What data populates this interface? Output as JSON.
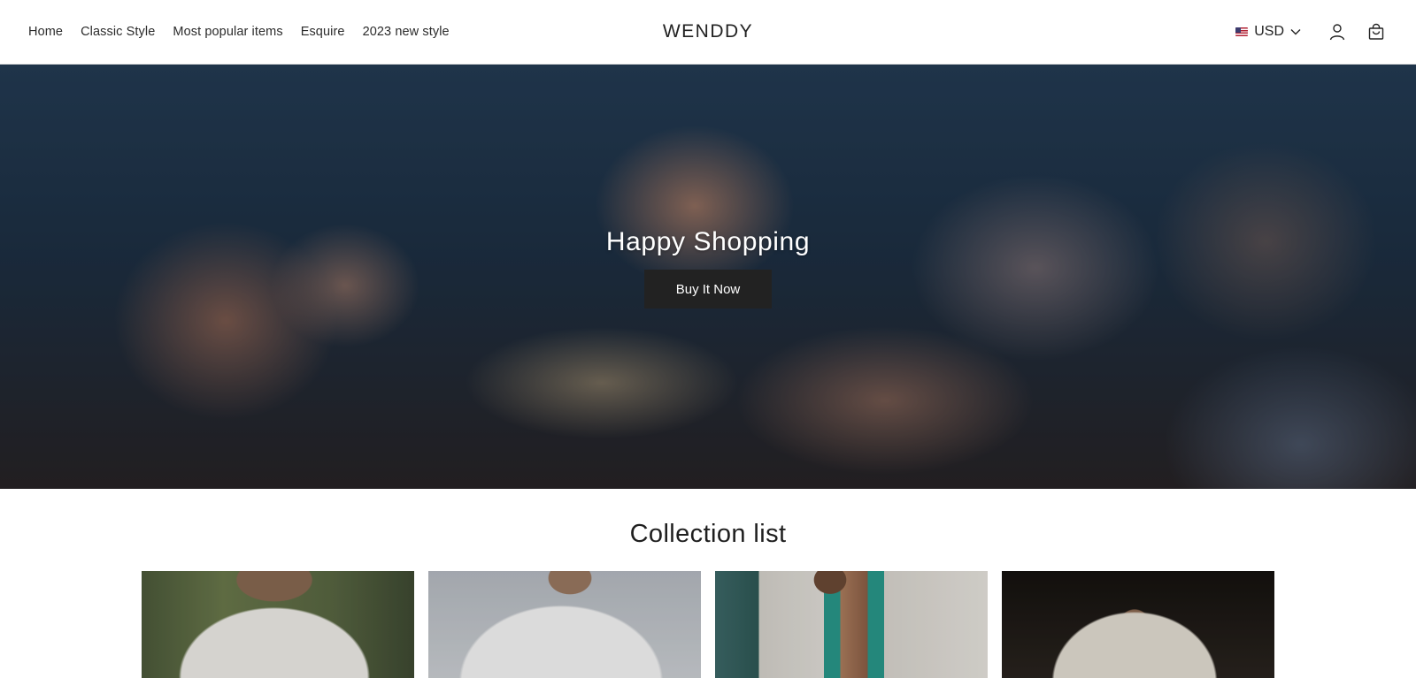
{
  "header": {
    "nav": [
      {
        "label": "Home"
      },
      {
        "label": "Classic Style"
      },
      {
        "label": "Most popular items"
      },
      {
        "label": "Esquire"
      },
      {
        "label": "2023 new style"
      }
    ],
    "logo": "WENDDY",
    "currency": {
      "label": "USD",
      "flag_icon": "us-flag-icon"
    },
    "icons": {
      "account": "user-icon",
      "cart": "shopping-bag-icon",
      "dropdown": "chevron-down-icon"
    }
  },
  "hero": {
    "title": "Happy Shopping",
    "button_label": "Buy It Now",
    "button_color": "#222222"
  },
  "collection": {
    "title": "Collection list",
    "items": [
      {
        "image": "man-white-henley-shirt-image"
      },
      {
        "image": "man-white-lace-up-shirt-image"
      },
      {
        "image": "man-teal-trim-cardigan-image"
      },
      {
        "image": "man-beige-linen-shirt-image"
      }
    ]
  }
}
